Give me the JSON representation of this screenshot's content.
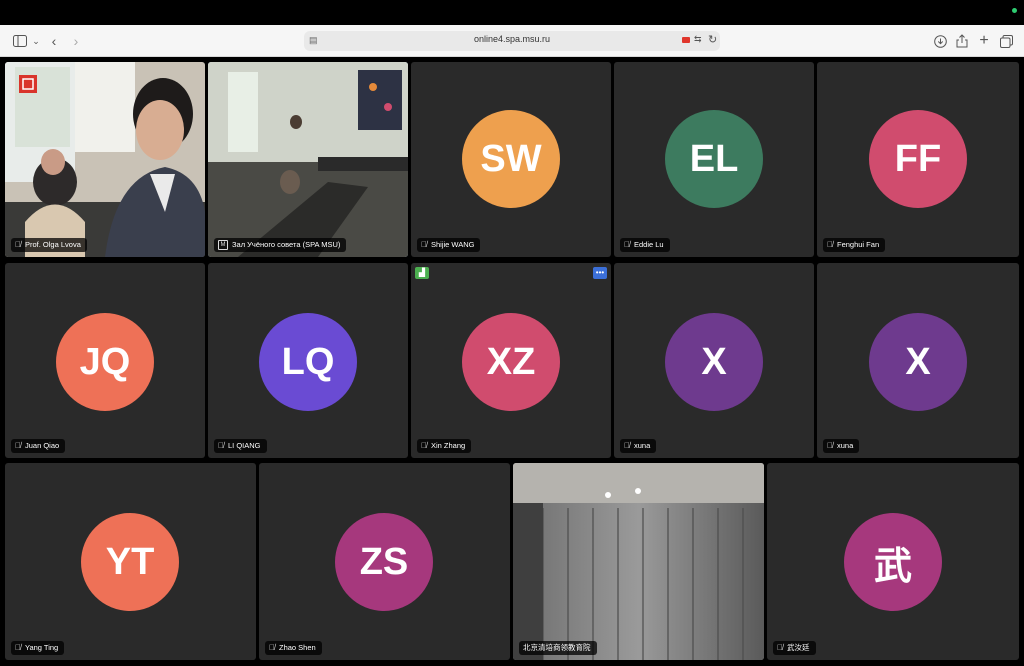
{
  "browser": {
    "url": "online4.spa.msu.ru",
    "icons": [
      "sidebar-icon",
      "chevron-down-icon",
      "back-icon",
      "forward-icon",
      "page-icon",
      "camera-icon",
      "translate-icon",
      "reload-icon",
      "download-icon",
      "share-icon",
      "new-tab-icon",
      "tabs-overview-icon"
    ]
  },
  "participants": [
    {
      "name": "Prof. Olga Lvova",
      "video": true
    },
    {
      "name": "Зал Учёного совета (SPA MSU)",
      "video": true,
      "active": true
    },
    {
      "name": "Shijie WANG",
      "initials": "SW",
      "color": "#eea04e"
    },
    {
      "name": "Eddie Lu",
      "initials": "EL",
      "color": "#3d7b5f"
    },
    {
      "name": "Fenghui Fan",
      "initials": "FF",
      "color": "#d04c6e"
    },
    {
      "name": "Juan Qiao",
      "initials": "JQ",
      "color": "#ee7157"
    },
    {
      "name": "LI QIANG",
      "initials": "LQ",
      "color": "#6a4bd3"
    },
    {
      "name": "Xin Zhang",
      "initials": "XZ",
      "color": "#d04c6e"
    },
    {
      "name": "xuna",
      "initials": "X",
      "color": "#6e3a8e"
    },
    {
      "name": "xuna",
      "initials": "X",
      "color": "#6e3a8e"
    },
    {
      "name": "Yang Ting",
      "initials": "YT",
      "color": "#ee7157"
    },
    {
      "name": "Zhao Shen",
      "initials": "ZS",
      "color": "#a6387d"
    },
    {
      "name": "北京清培商领教育院",
      "video": true
    },
    {
      "name": "武汝廷",
      "initials": "武",
      "color": "#a6387d"
    }
  ]
}
